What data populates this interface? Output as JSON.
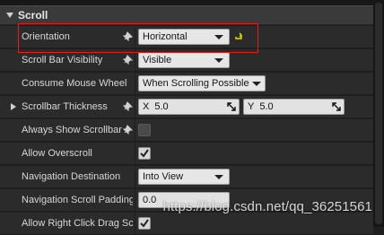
{
  "section": {
    "title": "Scroll"
  },
  "rows": [
    {
      "label": "Orientation",
      "control": "combo",
      "value": "Horizontal",
      "has_reset": true
    },
    {
      "label": "Scroll Bar Visibility",
      "control": "combo",
      "value": "Visible"
    },
    {
      "label": "Consume Mouse Wheel",
      "control": "combo",
      "value": "When Scrolling Possible"
    },
    {
      "label": "Scrollbar Thickness",
      "control": "vector2",
      "x_axis": "X",
      "x_value": "5.0",
      "y_axis": "Y",
      "y_value": "5.0",
      "expandable": true
    },
    {
      "label": "Always Show Scrollbar",
      "control": "checkbox",
      "checked": false
    },
    {
      "label": "Allow Overscroll",
      "control": "checkbox",
      "checked": true
    },
    {
      "label": "Navigation Destination",
      "control": "combo",
      "value": "Into View"
    },
    {
      "label": "Navigation Scroll Padding",
      "control": "number",
      "value": "0.0"
    },
    {
      "label": "Allow Right Click Drag Scrolling",
      "control": "checkbox",
      "checked": true
    }
  ],
  "watermark": "https://blog.csdn.net/qq_36251561",
  "colors": {
    "highlight": "#e31d1d",
    "reset_icon": "#f0e000"
  },
  "icons": {
    "section_toggle": "chevron-down-icon",
    "pin": "pin-icon",
    "reset": "reset-to-default-icon",
    "expand": "chevron-right-icon",
    "check": "checkmark-icon",
    "grip": "resize-grip-icon"
  }
}
